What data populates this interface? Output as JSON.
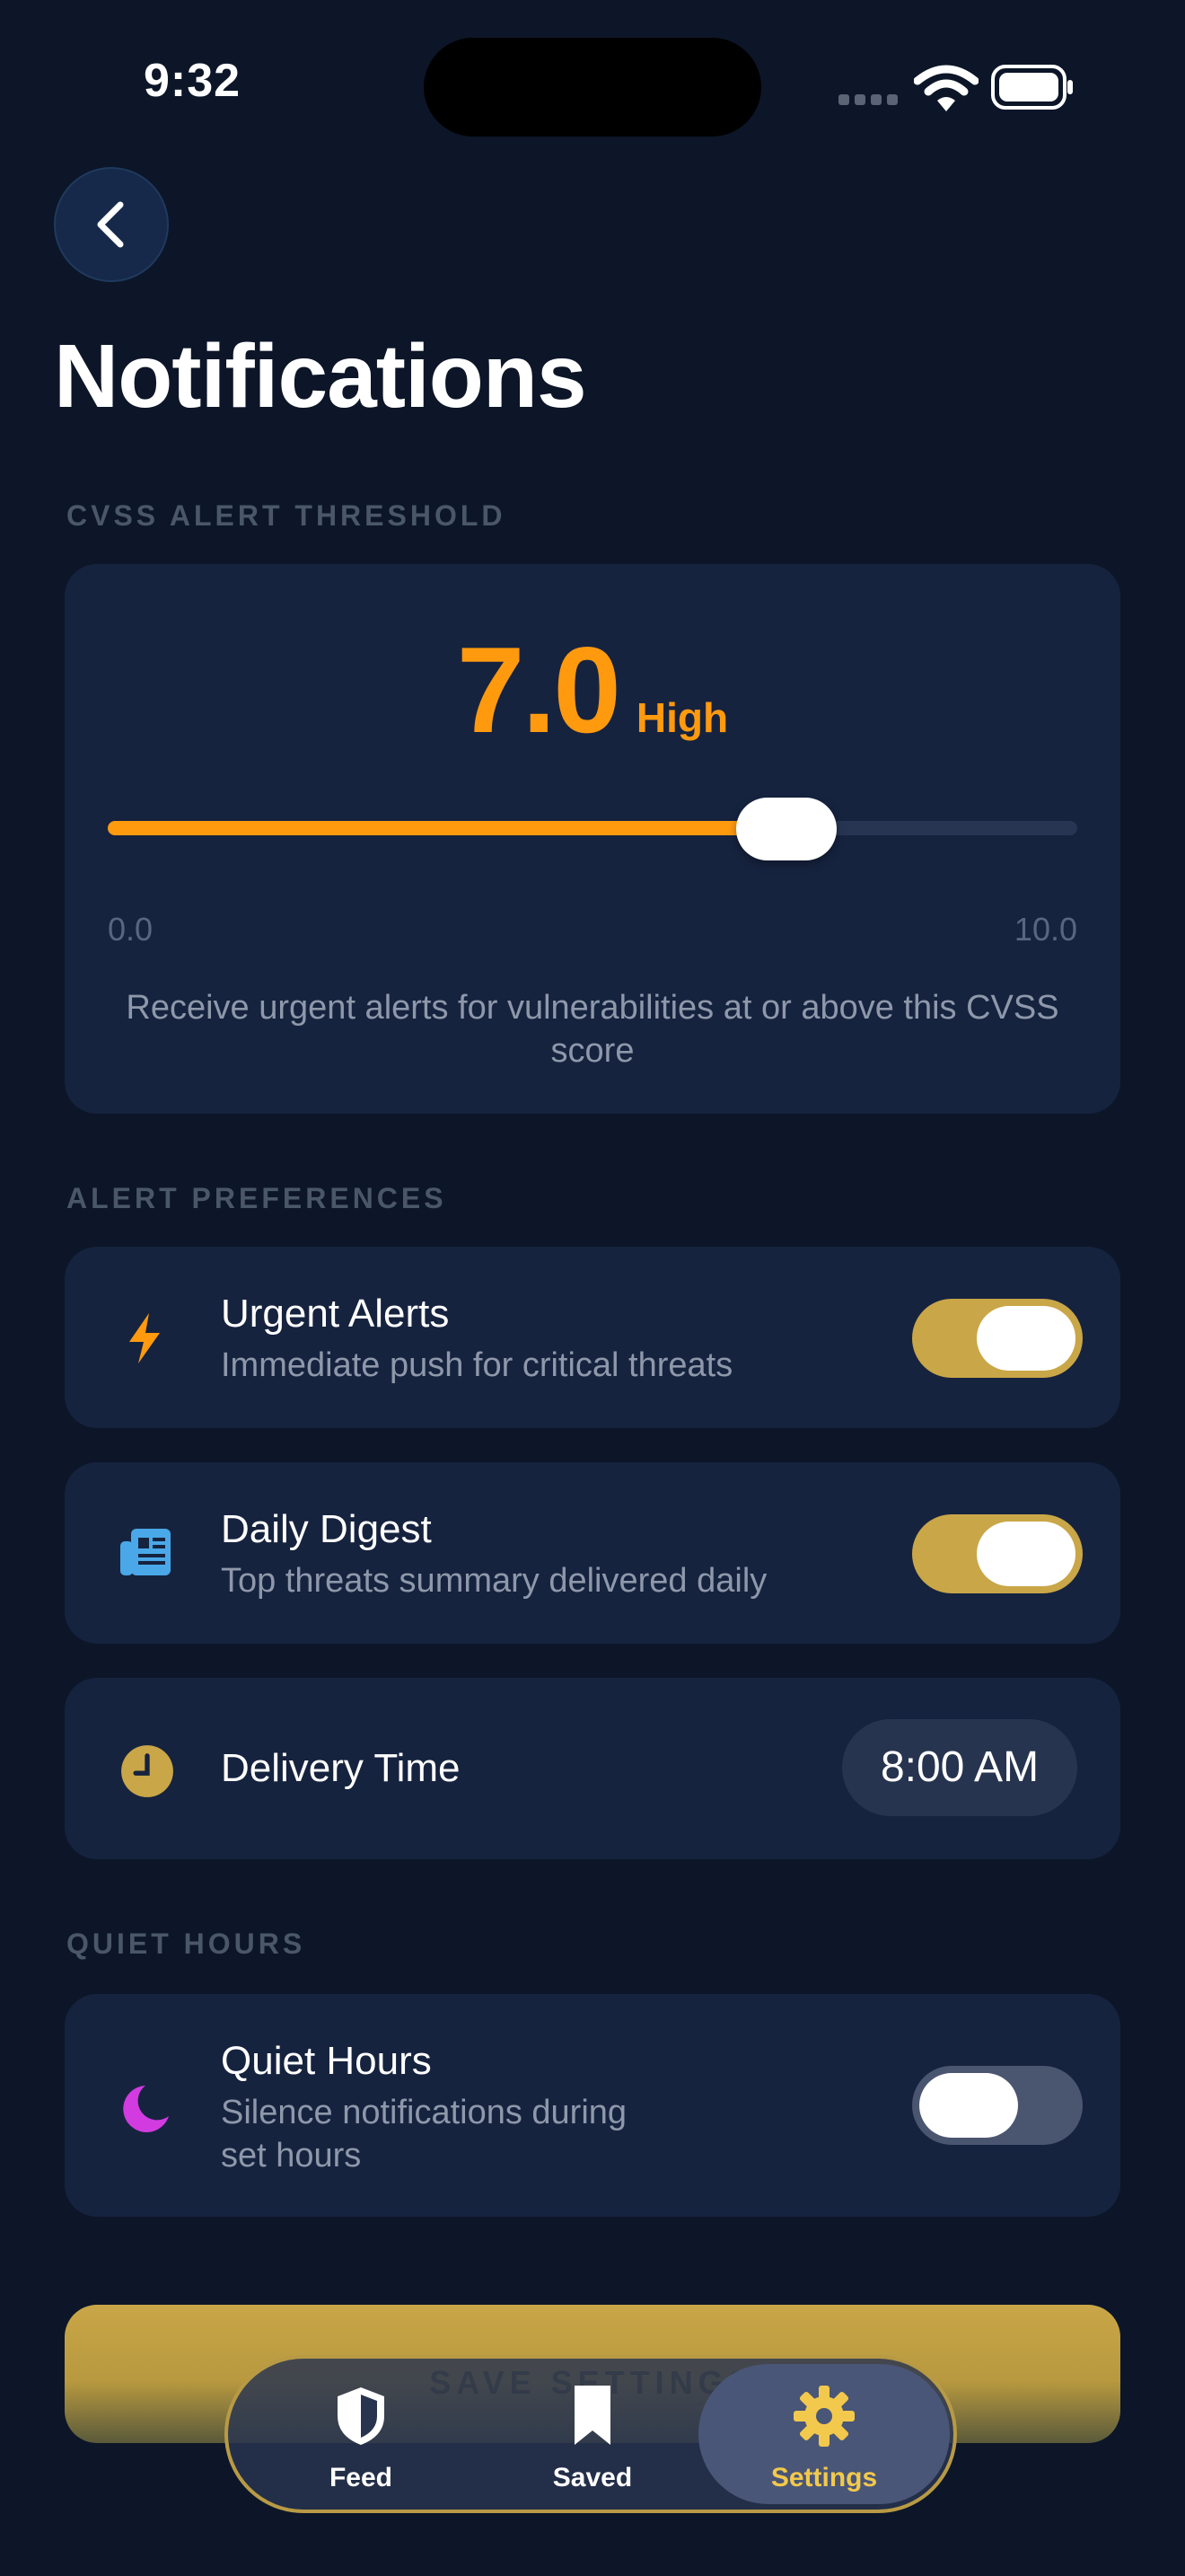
{
  "status_bar": {
    "time": "9:32"
  },
  "header": {
    "title": "Notifications"
  },
  "threshold": {
    "section_label": "CVSS ALERT THRESHOLD",
    "value": "7.0",
    "severity": "High",
    "slider_fraction": 0.7,
    "min_label": "0.0",
    "max_label": "10.0",
    "description": "Receive urgent alerts for vulnerabilities at or above this CVSS score"
  },
  "alert_prefs": {
    "section_label": "ALERT PREFERENCES",
    "urgent": {
      "title": "Urgent Alerts",
      "subtitle": "Immediate push for critical threats",
      "enabled": true
    },
    "digest": {
      "title": "Daily Digest",
      "subtitle": "Top threats summary delivered daily",
      "enabled": true
    },
    "delivery": {
      "title": "Delivery Time",
      "value": "8:00 AM"
    }
  },
  "quiet": {
    "section_label": "QUIET HOURS",
    "title": "Quiet Hours",
    "subtitle_line1": "Silence notifications during",
    "subtitle_line2": "set hours",
    "enabled": false
  },
  "save_button": {
    "label": "SAVE SETTINGS"
  },
  "tabs": {
    "feed": "Feed",
    "saved": "Saved",
    "settings": "Settings",
    "active": "settings"
  },
  "colors": {
    "background": "#0c1628",
    "card": "#16233f",
    "accent_orange": "#ff9a0f",
    "accent_gold": "#c9a647",
    "digest_icon": "#4aa8e8",
    "moon_icon": "#d23be0"
  },
  "icons": {
    "back": "chevron-left-icon",
    "urgent": "bolt-icon",
    "digest": "newspaper-icon",
    "delivery": "clock-icon",
    "quiet": "moon-icon",
    "feed": "shield-icon",
    "saved": "bookmark-icon",
    "settings": "gear-icon"
  }
}
